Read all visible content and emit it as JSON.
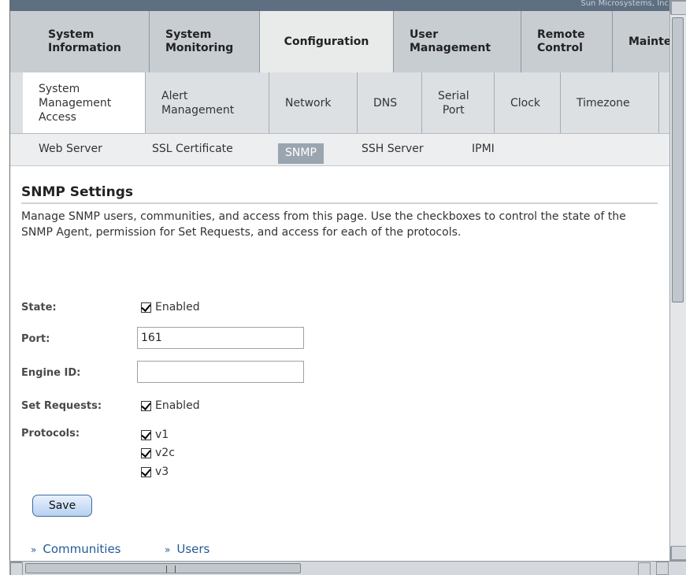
{
  "brand_text": "Sun Microsystems, Inc",
  "primary_tabs": [
    {
      "label": "System\nInformation",
      "active": false
    },
    {
      "label": "System\nMonitoring",
      "active": false
    },
    {
      "label": "Configuration",
      "active": true
    },
    {
      "label": "User\nManagement",
      "active": false
    },
    {
      "label": "Remote\nControl",
      "active": false
    },
    {
      "label": "Mainte",
      "active": false
    }
  ],
  "secondary_tabs": [
    {
      "label": "System\nManagement\nAccess",
      "active": true
    },
    {
      "label": "Alert\nManagement",
      "active": false
    },
    {
      "label": "Network",
      "active": false
    },
    {
      "label": "DNS",
      "active": false
    },
    {
      "label": "Serial\nPort",
      "active": false
    },
    {
      "label": "Clock",
      "active": false
    },
    {
      "label": "Timezone",
      "active": false
    }
  ],
  "tertiary_tabs": [
    {
      "label": "Web Server",
      "active": false
    },
    {
      "label": "SSL Certificate",
      "active": false
    },
    {
      "label": "SNMP",
      "active": true
    },
    {
      "label": "SSH Server",
      "active": false
    },
    {
      "label": "IPMI",
      "active": false
    }
  ],
  "page": {
    "title": "SNMP Settings",
    "description": "Manage SNMP users, communities, and access from this page. Use the checkboxes to control the state of the SNMP Agent, permission for Set Requests, and access for each of the protocols."
  },
  "form": {
    "state_label": "State:",
    "state_option": "Enabled",
    "state_checked": true,
    "port_label": "Port:",
    "port_value": "161",
    "engine_label": "Engine ID:",
    "engine_value": "",
    "set_requests_label": "Set Requests:",
    "set_requests_option": "Enabled",
    "set_requests_checked": true,
    "protocols_label": "Protocols:",
    "protocols": [
      {
        "label": "v1",
        "checked": true
      },
      {
        "label": "v2c",
        "checked": true
      },
      {
        "label": "v3",
        "checked": true
      }
    ],
    "save_label": "Save"
  },
  "footer_links": [
    {
      "label": "Communities",
      "icon": "double-chevron-down-icon"
    },
    {
      "label": "Users",
      "icon": "double-chevron-down-icon"
    }
  ]
}
